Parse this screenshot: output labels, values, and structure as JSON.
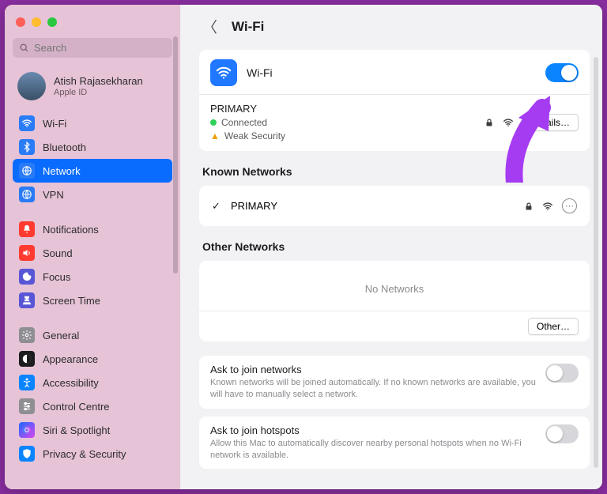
{
  "search": {
    "placeholder": "Search"
  },
  "account": {
    "name": "Atish Rajasekharan",
    "sub": "Apple ID"
  },
  "sidebar": {
    "group1": [
      {
        "label": "Wi-Fi",
        "icon": "wifi"
      },
      {
        "label": "Bluetooth",
        "icon": "bt"
      },
      {
        "label": "Network",
        "icon": "net",
        "selected": true
      },
      {
        "label": "VPN",
        "icon": "vpn"
      }
    ],
    "group2": [
      {
        "label": "Notifications",
        "icon": "notif"
      },
      {
        "label": "Sound",
        "icon": "sound"
      },
      {
        "label": "Focus",
        "icon": "focus"
      },
      {
        "label": "Screen Time",
        "icon": "screen"
      }
    ],
    "group3": [
      {
        "label": "General",
        "icon": "general"
      },
      {
        "label": "Appearance",
        "icon": "appearance"
      },
      {
        "label": "Accessibility",
        "icon": "access"
      },
      {
        "label": "Control Centre",
        "icon": "control"
      },
      {
        "label": "Siri & Spotlight",
        "icon": "siri"
      },
      {
        "label": "Privacy & Security",
        "icon": "privacy"
      }
    ]
  },
  "page": {
    "title": "Wi-Fi",
    "wifi_label": "Wi-Fi",
    "wifi_on": true,
    "current": {
      "ssid": "PRIMARY",
      "status": "Connected",
      "warning": "Weak Security",
      "details_btn": "Details…"
    },
    "known_header": "Known Networks",
    "known": [
      {
        "ssid": "PRIMARY",
        "connected": true
      }
    ],
    "other_header": "Other Networks",
    "no_networks": "No Networks",
    "other_btn": "Other…",
    "settings": [
      {
        "title": "Ask to join networks",
        "desc": "Known networks will be joined automatically. If no known networks are available, you will have to manually select a network.",
        "on": false
      },
      {
        "title": "Ask to join hotspots",
        "desc": "Allow this Mac to automatically discover nearby personal hotspots when no Wi-Fi network is available.",
        "on": false
      }
    ]
  }
}
